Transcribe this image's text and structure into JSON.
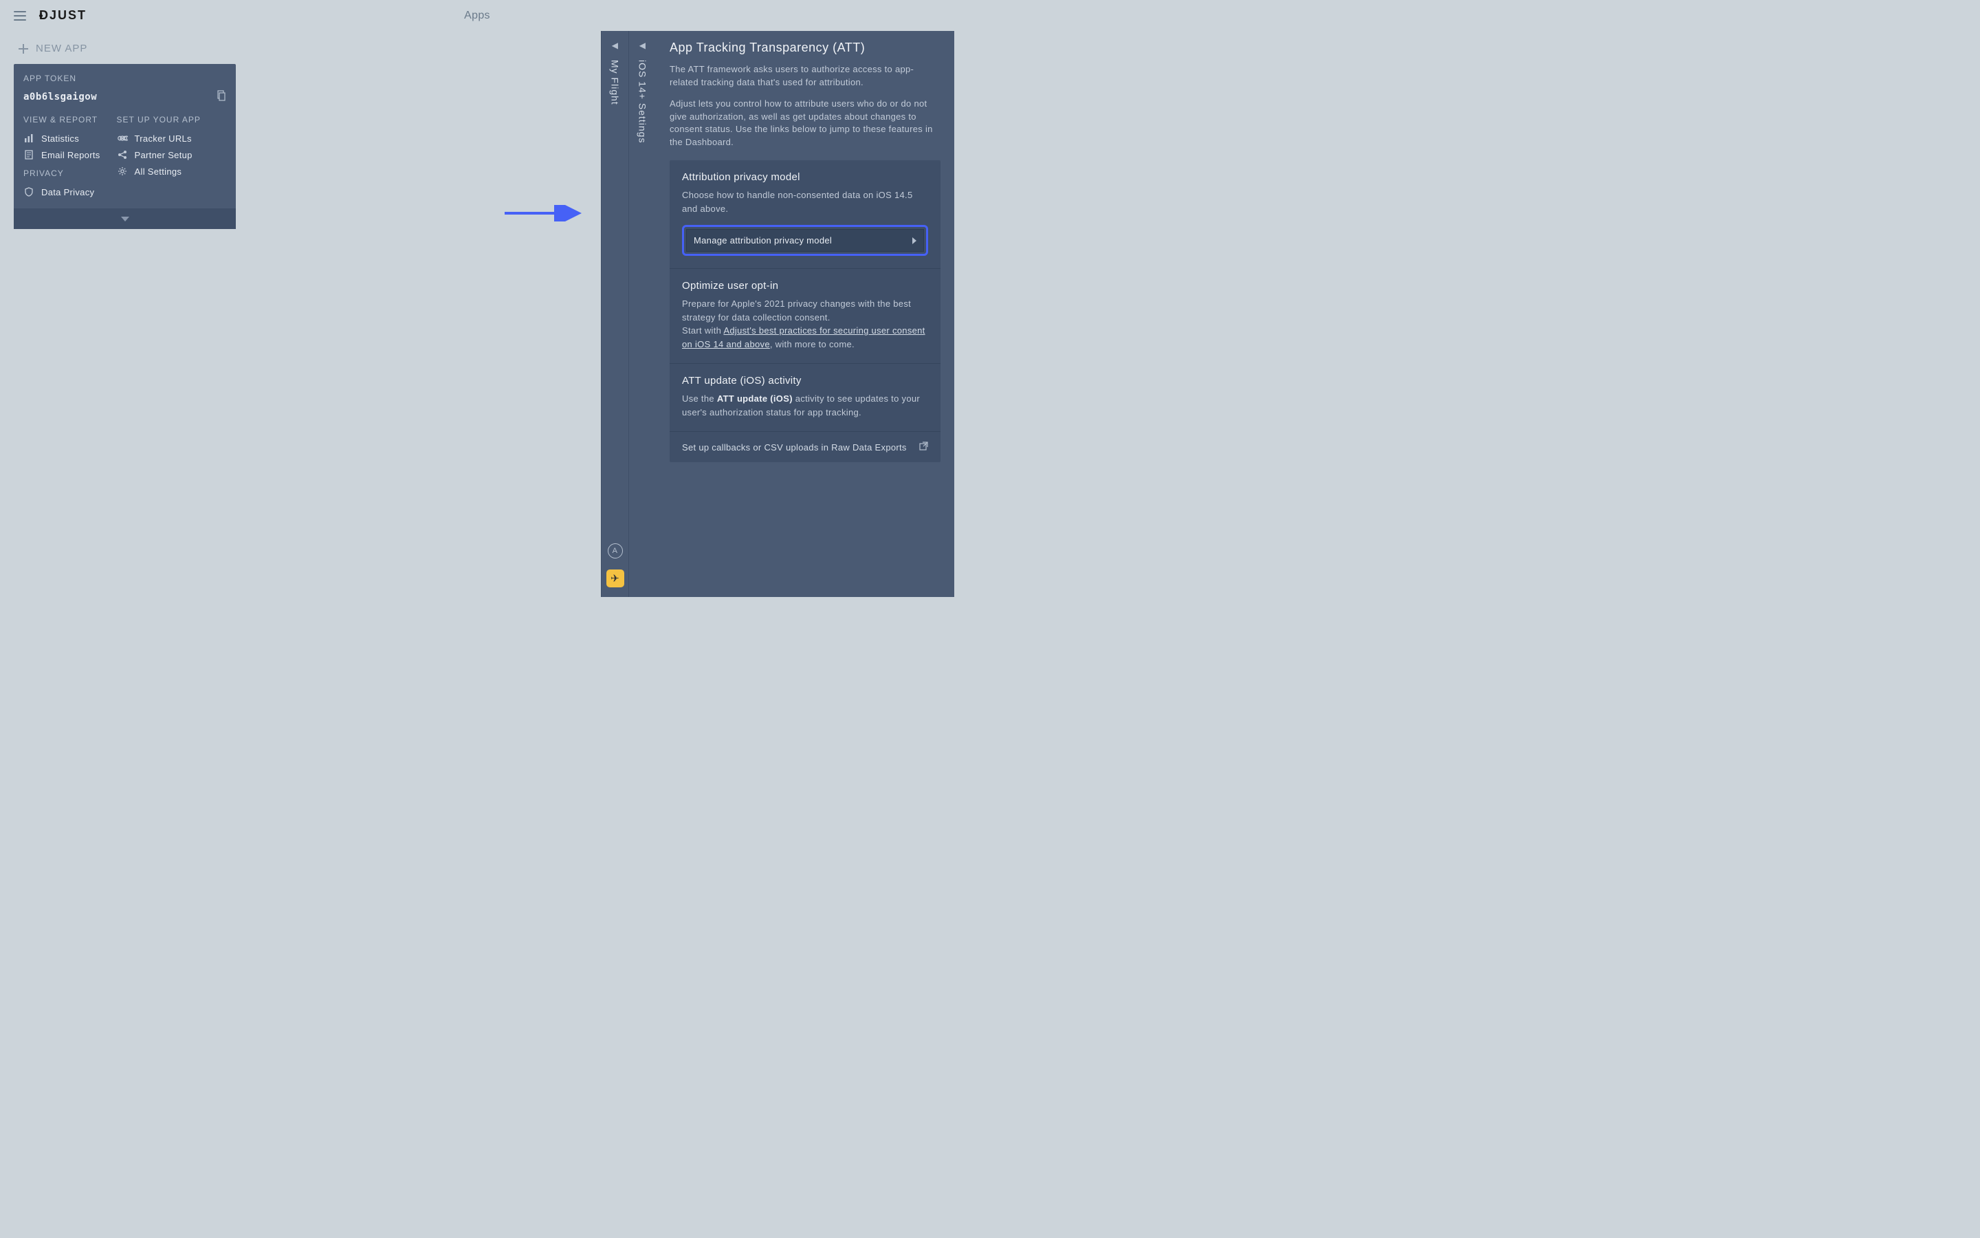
{
  "header": {
    "logo_text": "DJUST",
    "page_title": "Apps"
  },
  "new_app_label": "NEW APP",
  "card": {
    "token_label": "APP TOKEN",
    "token_value": "a0b6lsgaigow",
    "col1_head": "VIEW & REPORT",
    "statistics": "Statistics",
    "email_reports": "Email Reports",
    "privacy_head": "PRIVACY",
    "data_privacy": "Data Privacy",
    "col2_head": "SET UP YOUR APP",
    "tracker_urls": "Tracker URLs",
    "partner_setup": "Partner Setup",
    "all_settings": "All Settings"
  },
  "side_tabs": {
    "t1": "My Flight",
    "t2": "iOS 14+ Settings"
  },
  "panel": {
    "title": "App Tracking Transparency (ATT)",
    "desc1": "The ATT framework asks users to authorize access to app-related tracking data that's used for attribution.",
    "desc2": "Adjust lets you control how to attribute users who do or do not give authorization, as well as get updates about changes to consent status. Use the links below to jump to these features in the Dashboard.",
    "sec1": {
      "title": "Attribution privacy model",
      "text": "Choose how to handle non-consented data on iOS 14.5 and above.",
      "btn": "Manage attribution privacy model"
    },
    "sec2": {
      "title": "Optimize user opt-in",
      "line1": "Prepare for Apple's 2021 privacy changes with the best strategy for data collection consent.",
      "line2a": "Start with ",
      "link": "Adjust's best practices for securing user consent on iOS 14 and above",
      "line2b": ", with more to come."
    },
    "sec3": {
      "title": "ATT update (iOS) activity",
      "pre": "Use the ",
      "bold": "ATT update (iOS)",
      "post": " activity to see updates to your user's authorization status for app tracking."
    },
    "sec4": {
      "text": "Set up callbacks or CSV uploads in Raw Data Exports"
    }
  }
}
